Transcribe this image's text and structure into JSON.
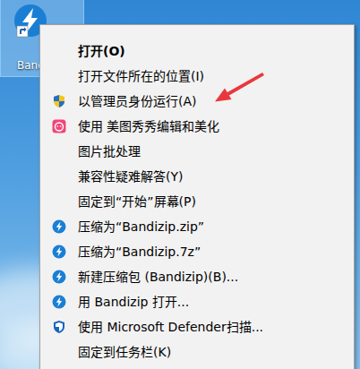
{
  "desktop_icon": {
    "label": "Band",
    "selected": true
  },
  "menu": {
    "items": [
      {
        "label": "打开(O)",
        "kind": "none",
        "default": true,
        "arrow": false
      },
      {
        "label": "打开文件所在的位置(I)",
        "kind": "none",
        "default": false,
        "arrow": false
      },
      {
        "label": "以管理员身份运行(A)",
        "kind": "shield",
        "default": false,
        "arrow": true
      },
      {
        "label": "使用 美图秀秀编辑和美化",
        "kind": "meitu",
        "default": false,
        "arrow": false
      },
      {
        "label": "图片批处理",
        "kind": "none",
        "default": false,
        "arrow": false
      },
      {
        "label": "兼容性疑难解答(Y)",
        "kind": "none",
        "default": false,
        "arrow": false
      },
      {
        "label": "固定到“开始”屏幕(P)",
        "kind": "none",
        "default": false,
        "arrow": false
      },
      {
        "label": "压缩为“Bandizip.zip”",
        "kind": "bandizip",
        "default": false,
        "arrow": false
      },
      {
        "label": "压缩为“Bandizip.7z”",
        "kind": "bandizip",
        "default": false,
        "arrow": false
      },
      {
        "label": "新建压缩包 (Bandizip)(B)...",
        "kind": "bandizip",
        "default": false,
        "arrow": false
      },
      {
        "label": "用 Bandizip 打开...",
        "kind": "bandizip",
        "default": false,
        "arrow": false
      },
      {
        "label": "使用 Microsoft Defender扫描...",
        "kind": "defender",
        "default": false,
        "arrow": false
      },
      {
        "label": "固定到任务栏(K)",
        "kind": "none",
        "default": false,
        "arrow": false
      }
    ]
  }
}
